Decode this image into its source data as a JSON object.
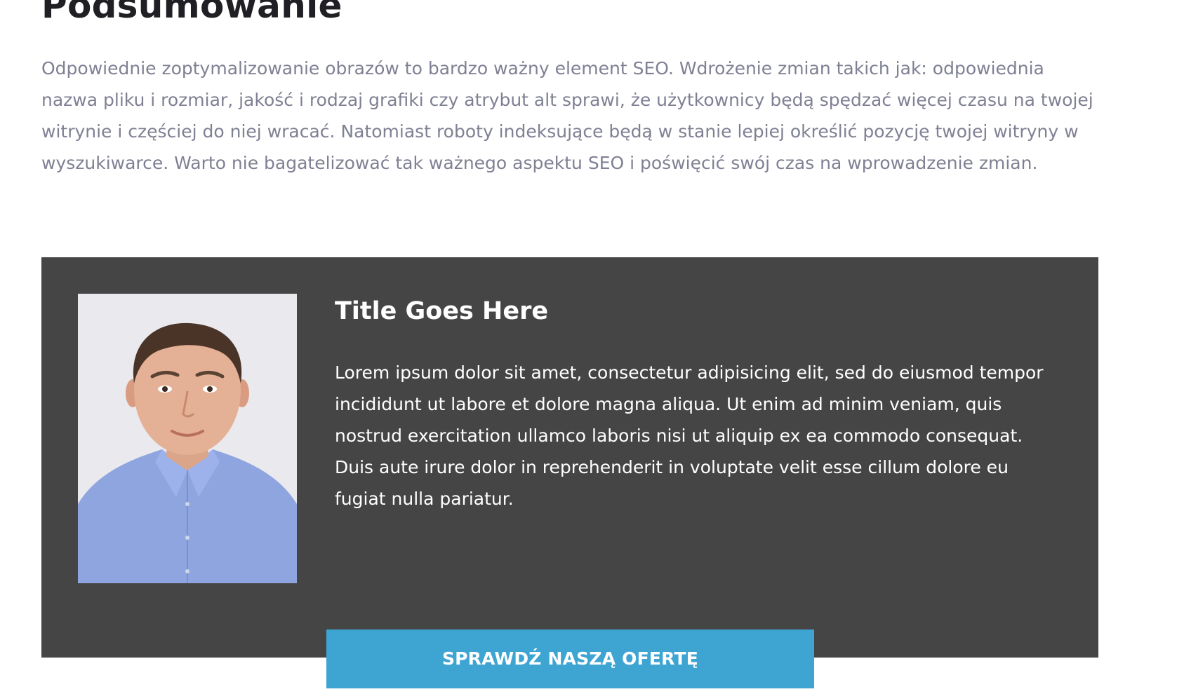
{
  "summary": {
    "heading": "Podsumowanie",
    "paragraph": "Odpowiednie zoptymalizowanie obrazów to bardzo ważny element SEO. Wdrożenie zmian takich jak: odpowiednia nazwa pliku i rozmiar, jakość i rodzaj grafiki czy atrybut alt sprawi, że użytkownicy będą spędzać więcej czasu na twojej witrynie i częściej do niej wracać. Natomiast roboty indeksujące będą w stanie lepiej określić pozycję twojej witryny w wyszukiwarce. Warto nie bagatelizować tak ważnego aspektu SEO i poświęcić swój czas na wprowadzenie zmian."
  },
  "author_card": {
    "title": "Title Goes Here",
    "body": "Lorem ipsum dolor sit amet, consectetur adipisicing elit, sed do eiusmod tempor incididunt ut labore et dolore magna aliqua. Ut enim ad minim veniam, quis nostrud exercitation ullamco laboris nisi ut aliquip ex ea commodo consequat. Duis aute irure dolor in reprehenderit in voluptate velit esse cillum dolore eu fugiat nulla pariatur.",
    "photo_icon": "author-photo"
  },
  "cta": {
    "label": "SPRAWDŹ NASZĄ OFERTĘ"
  },
  "colors": {
    "heading": "#1f1f24",
    "body_text": "#7f8093",
    "card_background": "#454545",
    "card_text": "#ffffff",
    "cta_background": "#3ea5d3",
    "photo_background": "#e9e9ee",
    "shirt": "#8fa5e0"
  }
}
